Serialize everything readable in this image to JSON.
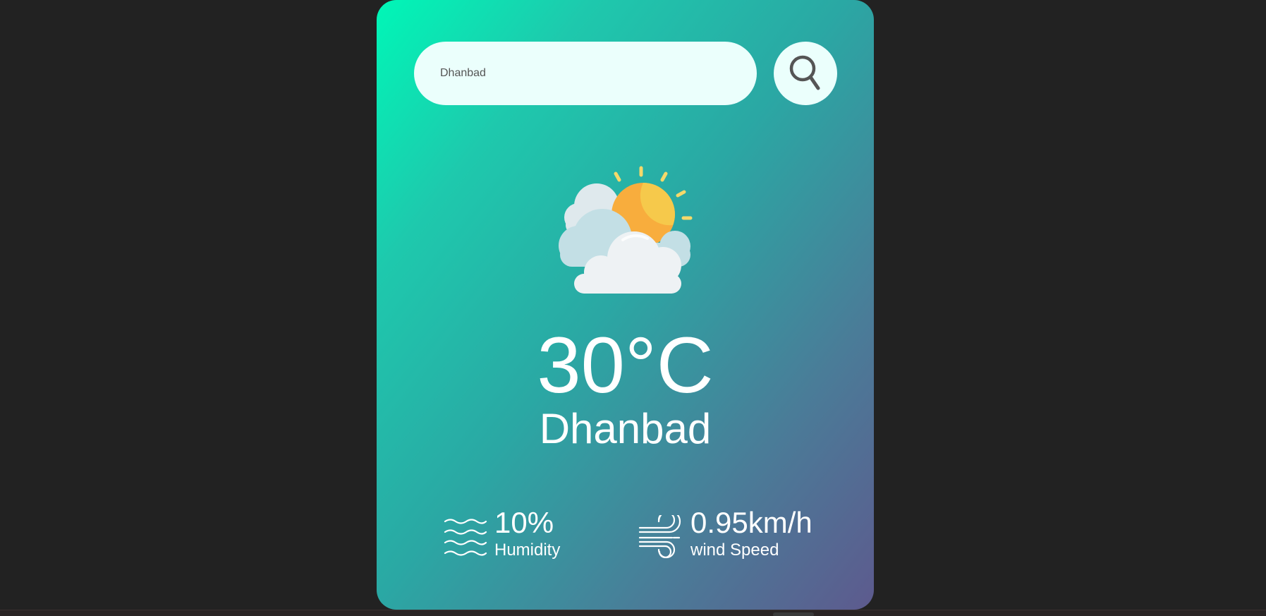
{
  "search": {
    "value": "Dhanbad",
    "icon": "search-icon"
  },
  "weather": {
    "icon": "partly-cloudy-icon",
    "temperature": "30°C",
    "city": "Dhanbad"
  },
  "details": {
    "humidity": {
      "icon": "humidity-waves-icon",
      "value": "10%",
      "label": "Humidity"
    },
    "wind": {
      "icon": "wind-icon",
      "value": "0.95km/h",
      "label": "wind Speed"
    }
  },
  "colors": {
    "page_background": "#222222",
    "card_gradient_start": "#00f7b7",
    "card_gradient_end": "#5d5a8e",
    "input_background": "#ebfffc",
    "text": "#ffffff"
  }
}
